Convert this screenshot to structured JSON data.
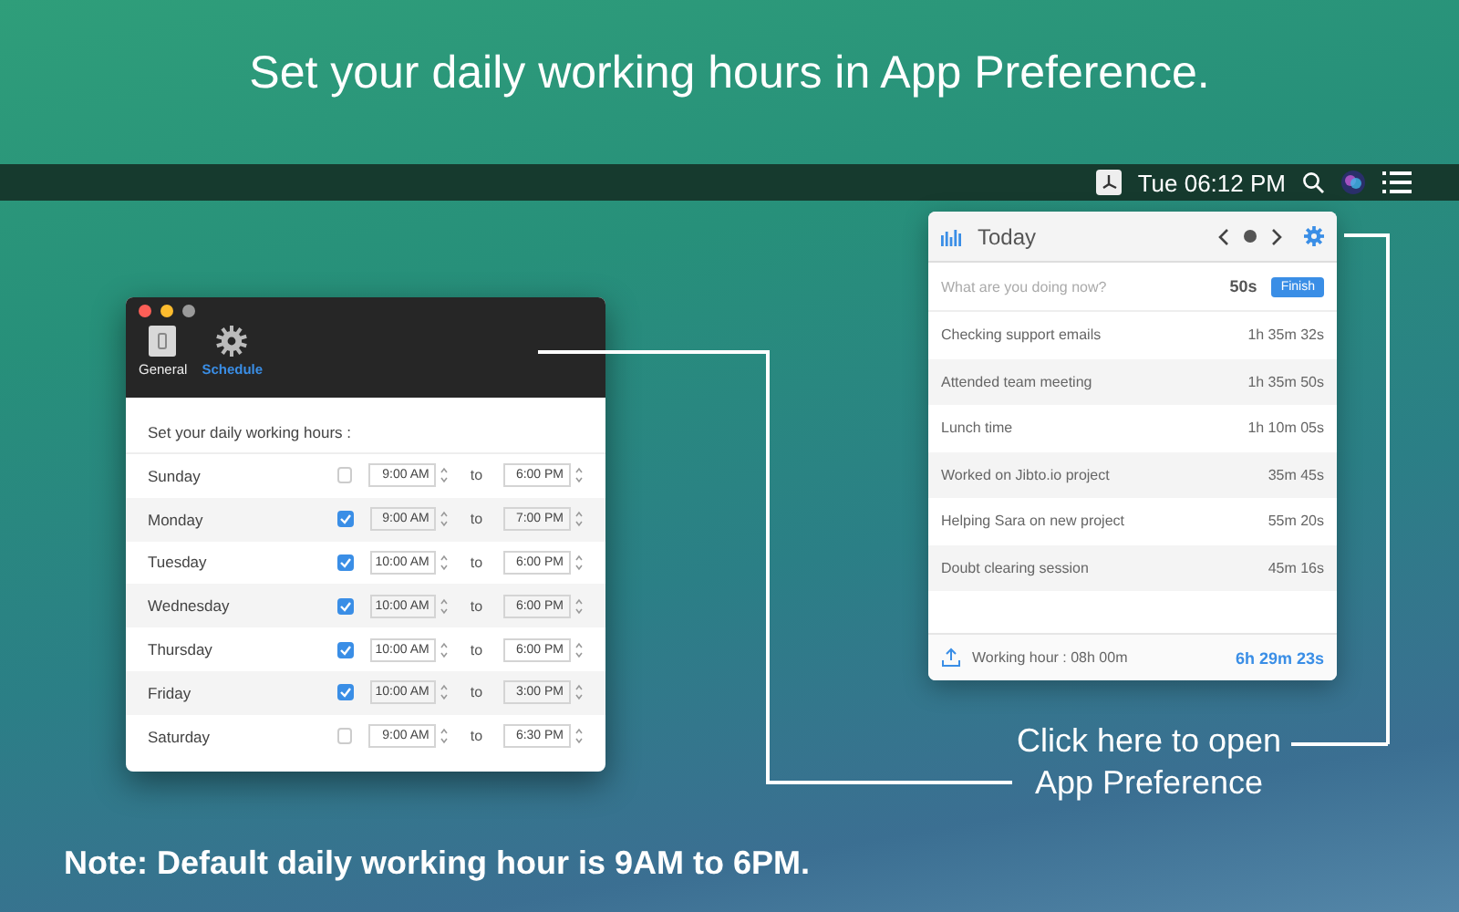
{
  "headline": "Set your daily working hours in App Preference.",
  "menu_bar": {
    "clock": "Tue 06:12 PM"
  },
  "popover": {
    "title": "Today",
    "prompt": {
      "placeholder": "What are you doing now?"
    },
    "elapsed": "50s",
    "finish_button": "Finish",
    "entries": [
      {
        "task": "Checking support emails",
        "duration": "1h 35m 32s"
      },
      {
        "task": "Attended team meeting",
        "duration": "1h 35m 50s"
      },
      {
        "task": "Lunch time",
        "duration": "1h 10m 05s"
      },
      {
        "task": "Worked on Jibto.io project",
        "duration": "35m 45s"
      },
      {
        "task": "Helping Sara on new project",
        "duration": "55m 20s"
      },
      {
        "task": "Doubt clearing session",
        "duration": "45m 16s"
      }
    ],
    "footer": {
      "working_hour": "Working hour : 08h 00m",
      "total": "6h 29m 23s"
    }
  },
  "preferences": {
    "tabs": [
      {
        "label": "General",
        "kind": "switch",
        "selected": false
      },
      {
        "label": "Schedule",
        "kind": "gear",
        "selected": true
      }
    ],
    "heading": "Set your daily working hours :",
    "days": [
      {
        "day": "Sunday",
        "enabled": false,
        "start": "9:00 AM",
        "to": "to",
        "end": "6:00 PM"
      },
      {
        "day": "Monday",
        "enabled": true,
        "start": "9:00 AM",
        "to": "to",
        "end": "7:00 PM"
      },
      {
        "day": "Tuesday",
        "enabled": true,
        "start": "10:00 AM",
        "to": "to",
        "end": "6:00 PM"
      },
      {
        "day": "Wednesday",
        "enabled": true,
        "start": "10:00 AM",
        "to": "to",
        "end": "6:00 PM"
      },
      {
        "day": "Thursday",
        "enabled": true,
        "start": "10:00 AM",
        "to": "to",
        "end": "6:00 PM"
      },
      {
        "day": "Friday",
        "enabled": true,
        "start": "10:00 AM",
        "to": "to",
        "end": "3:00 PM"
      },
      {
        "day": "Saturday",
        "enabled": false,
        "start": "9:00 AM",
        "to": "to",
        "end": "6:30 PM"
      }
    ]
  },
  "callout": [
    "Click here to open",
    "App Preference"
  ],
  "note": "Note: Default daily working hour is 9AM to 6PM."
}
